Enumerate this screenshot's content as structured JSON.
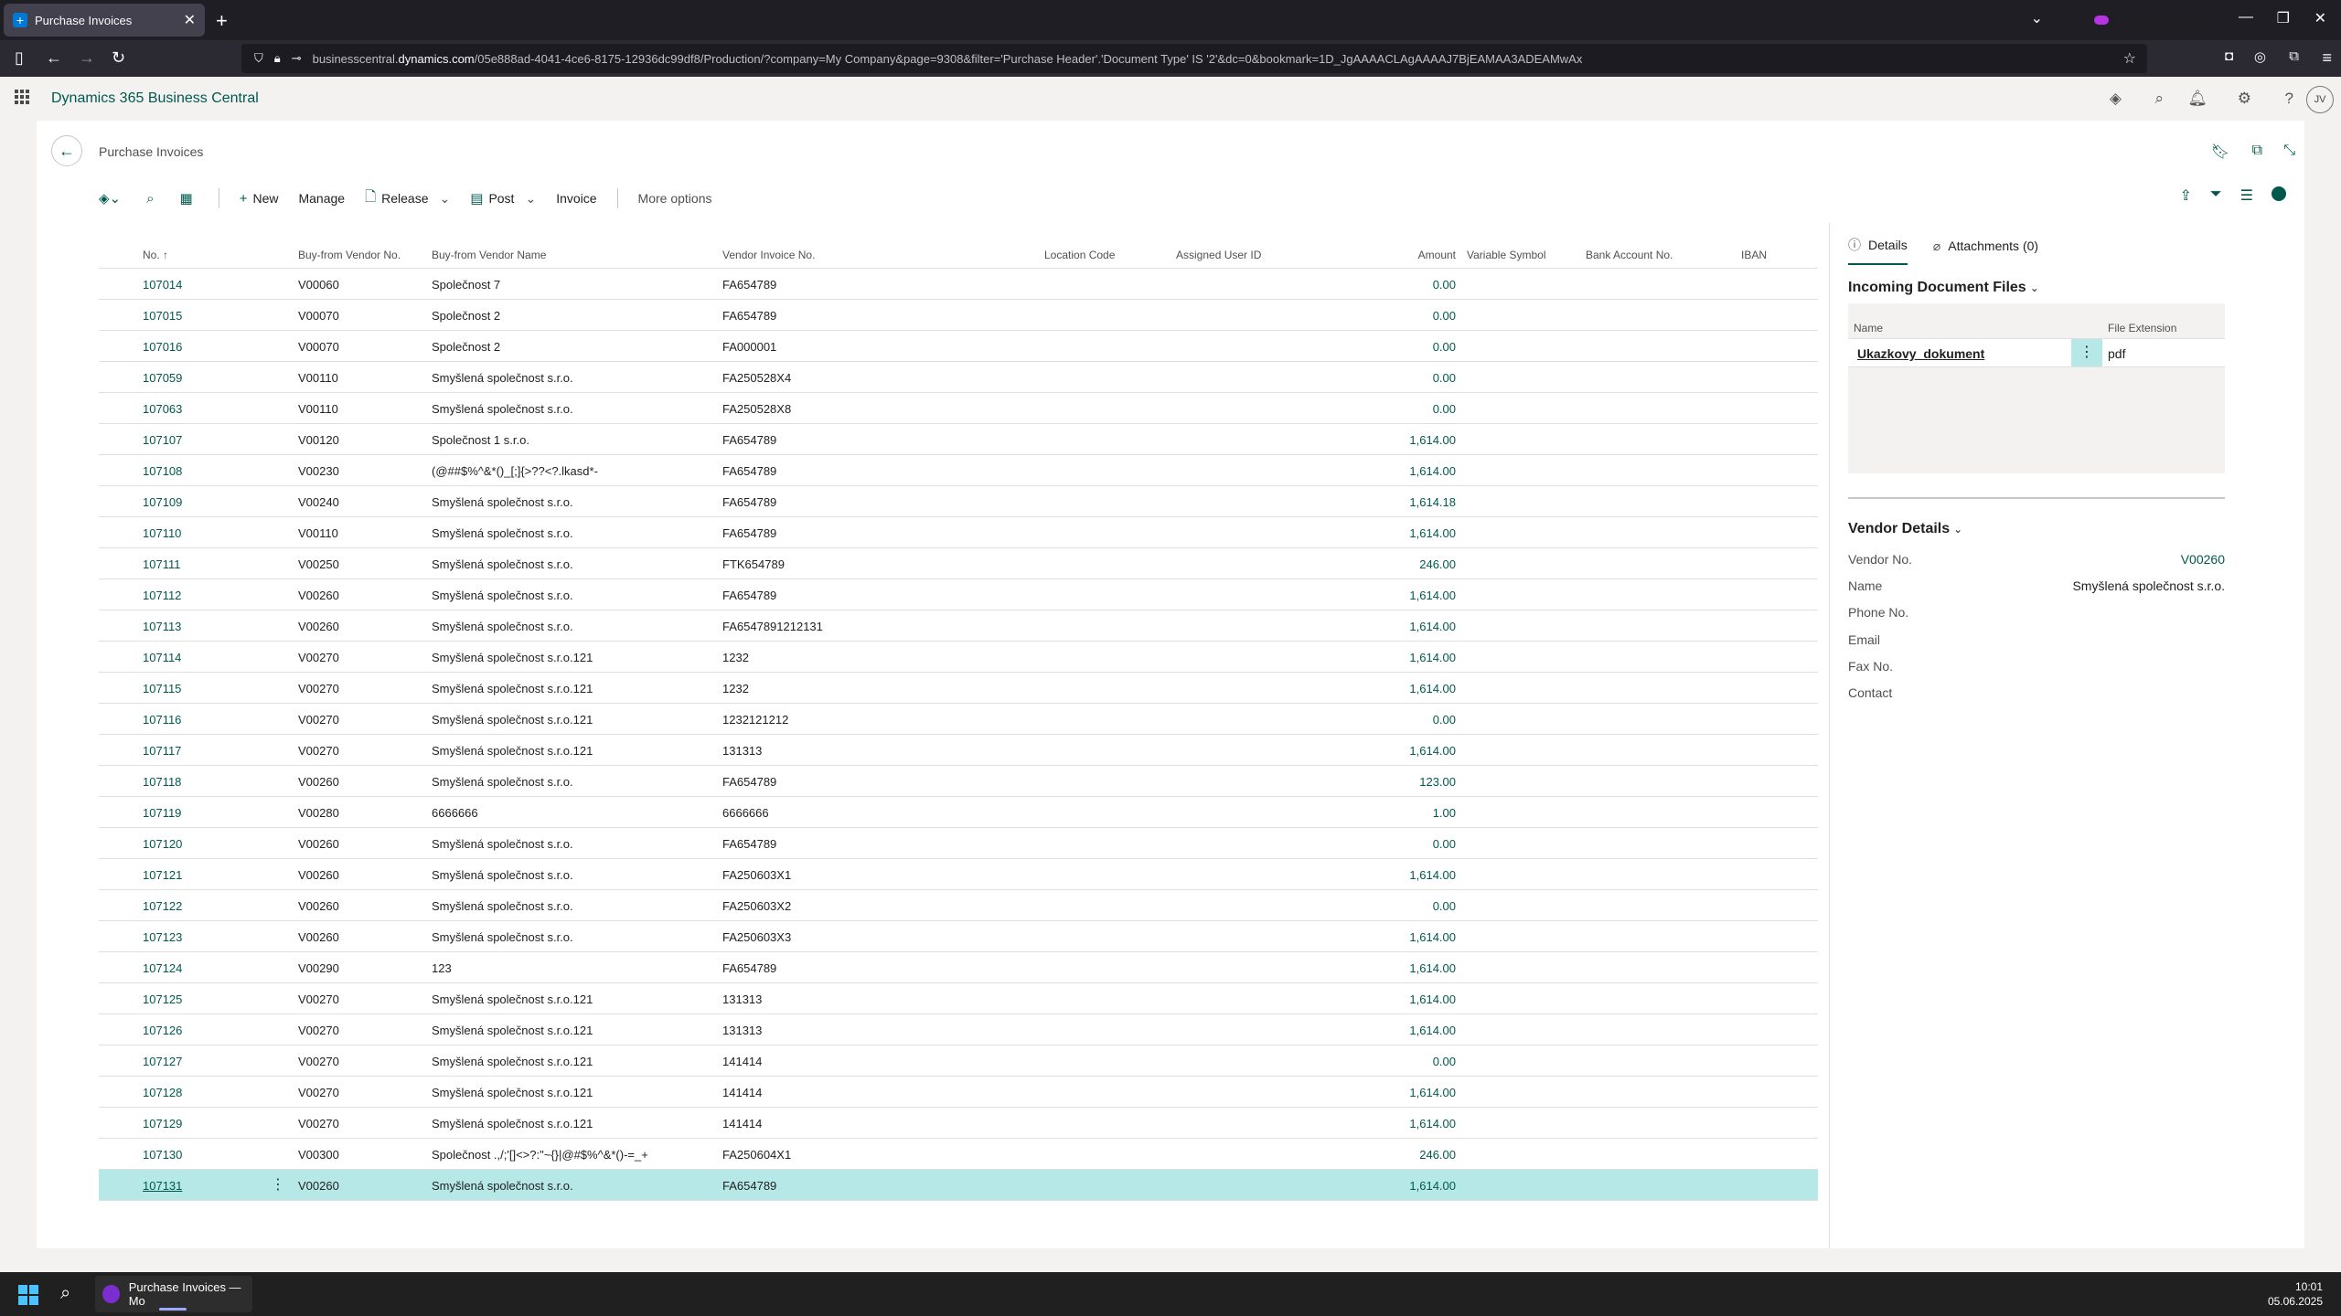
{
  "browser": {
    "tab_title": "Purchase Invoices",
    "private_label": "Private browsing",
    "url_prefix": "businesscentral.",
    "url_domain": "dynamics.com",
    "url_rest": "/05e888ad-4041-4ce6-8175-12936dc99df8/Production/?company=My Company&page=9308&filter='Purchase Header'.'Document Type' IS '2'&dc=0&bookmark=1D_JgAAAACLAgAAAAJ7BjEAMAA3ADEAMwAx"
  },
  "app": {
    "brand": "Dynamics 365 Business Central",
    "avatar": "JV"
  },
  "page": {
    "title": "Purchase Invoices",
    "actions": {
      "new": "New",
      "manage": "Manage",
      "release": "Release",
      "post": "Post",
      "invoice": "Invoice",
      "more": "More options"
    }
  },
  "grid": {
    "columns": {
      "no": "No. ↑",
      "vendor_no": "Buy-from Vendor No.",
      "vendor_name": "Buy-from Vendor Name",
      "vendor_invoice": "Vendor Invoice No.",
      "location": "Location Code",
      "user": "Assigned User ID",
      "amount": "Amount",
      "var_symbol": "Variable Symbol",
      "bank": "Bank Account No.",
      "iban": "IBAN"
    },
    "rows": [
      {
        "no": "107014",
        "vendor": "V00060",
        "name": "Společnost 7",
        "inv": "FA654789",
        "amount": "0.00"
      },
      {
        "no": "107015",
        "vendor": "V00070",
        "name": "Společnost 2",
        "inv": "FA654789",
        "amount": "0.00"
      },
      {
        "no": "107016",
        "vendor": "V00070",
        "name": "Společnost 2",
        "inv": "FA000001",
        "amount": "0.00"
      },
      {
        "no": "107059",
        "vendor": "V00110",
        "name": "Smyšlená společnost s.r.o.",
        "inv": "FA250528X4",
        "amount": "0.00"
      },
      {
        "no": "107063",
        "vendor": "V00110",
        "name": "Smyšlená společnost s.r.o.",
        "inv": "FA250528X8",
        "amount": "0.00"
      },
      {
        "no": "107107",
        "vendor": "V00120",
        "name": "Společnost 1 s.r.o.",
        "inv": "FA654789",
        "amount": "1,614.00"
      },
      {
        "no": "107108",
        "vendor": "V00230",
        "name": "(@##$%^&*()_[;]{>??<?.lkasd*-",
        "inv": "FA654789",
        "amount": "1,614.00"
      },
      {
        "no": "107109",
        "vendor": "V00240",
        "name": "Smyšlená společnost s.r.o.",
        "inv": "FA654789",
        "amount": "1,614.18"
      },
      {
        "no": "107110",
        "vendor": "V00110",
        "name": "Smyšlená společnost s.r.o.",
        "inv": "FA654789",
        "amount": "1,614.00"
      },
      {
        "no": "107111",
        "vendor": "V00250",
        "name": "Smyšlená společnost s.r.o.",
        "inv": "FTK654789",
        "amount": "246.00"
      },
      {
        "no": "107112",
        "vendor": "V00260",
        "name": "Smyšlená společnost s.r.o.",
        "inv": "FA654789",
        "amount": "1,614.00"
      },
      {
        "no": "107113",
        "vendor": "V00260",
        "name": "Smyšlená společnost s.r.o.",
        "inv": "FA6547891212131",
        "amount": "1,614.00"
      },
      {
        "no": "107114",
        "vendor": "V00270",
        "name": "Smyšlená společnost s.r.o.121",
        "inv": "1232",
        "amount": "1,614.00"
      },
      {
        "no": "107115",
        "vendor": "V00270",
        "name": "Smyšlená společnost s.r.o.121",
        "inv": "1232",
        "amount": "1,614.00"
      },
      {
        "no": "107116",
        "vendor": "V00270",
        "name": "Smyšlená společnost s.r.o.121",
        "inv": "1232121212",
        "amount": "0.00"
      },
      {
        "no": "107117",
        "vendor": "V00270",
        "name": "Smyšlená společnost s.r.o.121",
        "inv": "131313",
        "amount": "1,614.00"
      },
      {
        "no": "107118",
        "vendor": "V00260",
        "name": "Smyšlená společnost s.r.o.",
        "inv": "FA654789",
        "amount": "123.00"
      },
      {
        "no": "107119",
        "vendor": "V00280",
        "name": "6666666",
        "inv": "6666666",
        "amount": "1.00"
      },
      {
        "no": "107120",
        "vendor": "V00260",
        "name": "Smyšlená společnost s.r.o.",
        "inv": "FA654789",
        "amount": "0.00"
      },
      {
        "no": "107121",
        "vendor": "V00260",
        "name": "Smyšlená společnost s.r.o.",
        "inv": "FA250603X1",
        "amount": "1,614.00"
      },
      {
        "no": "107122",
        "vendor": "V00260",
        "name": "Smyšlená společnost s.r.o.",
        "inv": "FA250603X2",
        "amount": "0.00"
      },
      {
        "no": "107123",
        "vendor": "V00260",
        "name": "Smyšlená společnost s.r.o.",
        "inv": "FA250603X3",
        "amount": "1,614.00"
      },
      {
        "no": "107124",
        "vendor": "V00290",
        "name": "123",
        "inv": "FA654789",
        "amount": "1,614.00"
      },
      {
        "no": "107125",
        "vendor": "V00270",
        "name": "Smyšlená společnost s.r.o.121",
        "inv": "131313",
        "amount": "1,614.00"
      },
      {
        "no": "107126",
        "vendor": "V00270",
        "name": "Smyšlená společnost s.r.o.121",
        "inv": "131313",
        "amount": "1,614.00"
      },
      {
        "no": "107127",
        "vendor": "V00270",
        "name": "Smyšlená společnost s.r.o.121",
        "inv": "141414",
        "amount": "0.00"
      },
      {
        "no": "107128",
        "vendor": "V00270",
        "name": "Smyšlená společnost s.r.o.121",
        "inv": "141414",
        "amount": "1,614.00"
      },
      {
        "no": "107129",
        "vendor": "V00270",
        "name": "Smyšlená společnost s.r.o.121",
        "inv": "141414",
        "amount": "1,614.00"
      },
      {
        "no": "107130",
        "vendor": "V00300",
        "name": "Společnost .,/;'[]<>?:\"~{}|@#$%^&*()-=_+",
        "inv": "FA250604X1",
        "amount": "246.00"
      },
      {
        "no": "107131",
        "vendor": "V00260",
        "name": "Smyšlená společnost s.r.o.",
        "inv": "FA654789",
        "amount": "1,614.00",
        "selected": true
      }
    ]
  },
  "factbox": {
    "tab_details": "Details",
    "tab_attachments": "Attachments (0)",
    "incoming_title": "Incoming Document Files",
    "col_name": "Name",
    "col_ext": "File Extension",
    "doc_name": "Ukazkovy_dokument",
    "doc_ext": "pdf",
    "vendor_title": "Vendor Details",
    "vendor_no_label": "Vendor No.",
    "vendor_no_value": "V00260",
    "name_label": "Name",
    "name_value": "Smyšlená společnost s.r.o.",
    "phone_label": "Phone No.",
    "email_label": "Email",
    "fax_label": "Fax No.",
    "contact_label": "Contact"
  },
  "taskbar": {
    "app_label": "Purchase Invoices — Mo",
    "time": "10:01",
    "date": "05.06.2025"
  },
  "colors": {
    "accent": "#00594c",
    "selected_row": "#b5e8e6"
  }
}
